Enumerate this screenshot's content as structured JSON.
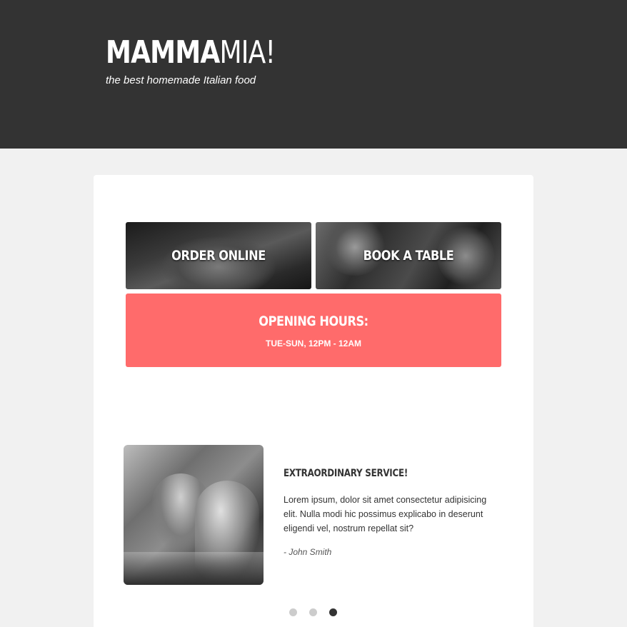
{
  "header": {
    "logo_bold": "MAMMA",
    "logo_light": "MIA!",
    "tagline": "the best homemade Italian food"
  },
  "tiles": {
    "order_label": "ORDER ONLINE",
    "book_label": "BOOK A TABLE"
  },
  "hours": {
    "title": "OPENING HOURS:",
    "text": "TUE-SUN, 12PM - 12AM"
  },
  "testimonial": {
    "title": "EXTRAORDINARY SERVICE!",
    "body": "Lorem ipsum, dolor sit amet consectetur adipisicing elit. Nulla modi hic possimus explicabo in deserunt eligendi vel, nostrum repellat sit?",
    "author": "- John Smith"
  },
  "carousel": {
    "active_index": 3,
    "count": 3
  },
  "colors": {
    "header_bg": "#333333",
    "accent": "#ff6b6b",
    "page_bg": "#f1f1f1"
  }
}
